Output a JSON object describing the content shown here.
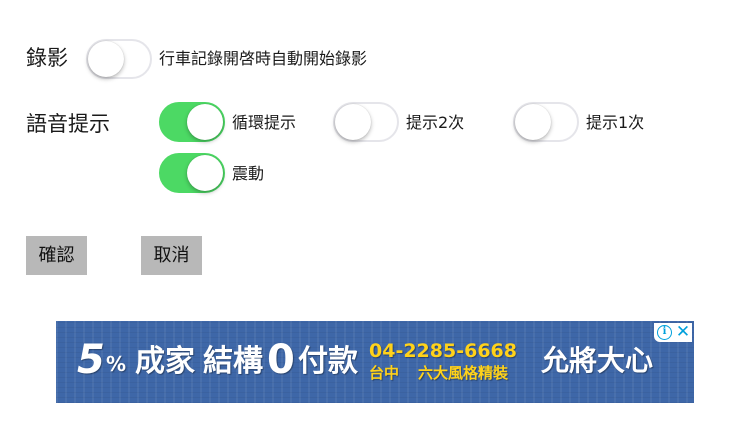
{
  "recording": {
    "label": "錄影",
    "toggle_description": "行車記錄開啓時自動開始錄影",
    "enabled": false
  },
  "voice_prompt": {
    "label": "語音提示",
    "options": [
      {
        "label": "循環提示",
        "enabled": true
      },
      {
        "label": "提示2次",
        "enabled": false
      },
      {
        "label": "提示1次",
        "enabled": false
      },
      {
        "label": "震動",
        "enabled": true
      }
    ]
  },
  "actions": {
    "confirm_label": "確認",
    "cancel_label": "取消"
  },
  "colors": {
    "switch_on": "#4cd964",
    "switch_off_border": "#e5e5ea",
    "button_bg": "#b8b8b8",
    "ad_bg": "#3e67a8",
    "ad_highlight": "#ffd21a",
    "ad_badge": "#00a0dc"
  },
  "ad_banner": {
    "headline_digit1": "5",
    "headline_percent": "%",
    "headline_part1": "成家",
    "headline_part2": "結構",
    "headline_digit2": "0",
    "headline_part3": "付款",
    "phone": "04-2285-6668",
    "location": "台中",
    "tagline": "六大風格精裝",
    "brand": "允將大心",
    "info_icon": "info-icon",
    "close_icon": "close-icon"
  }
}
